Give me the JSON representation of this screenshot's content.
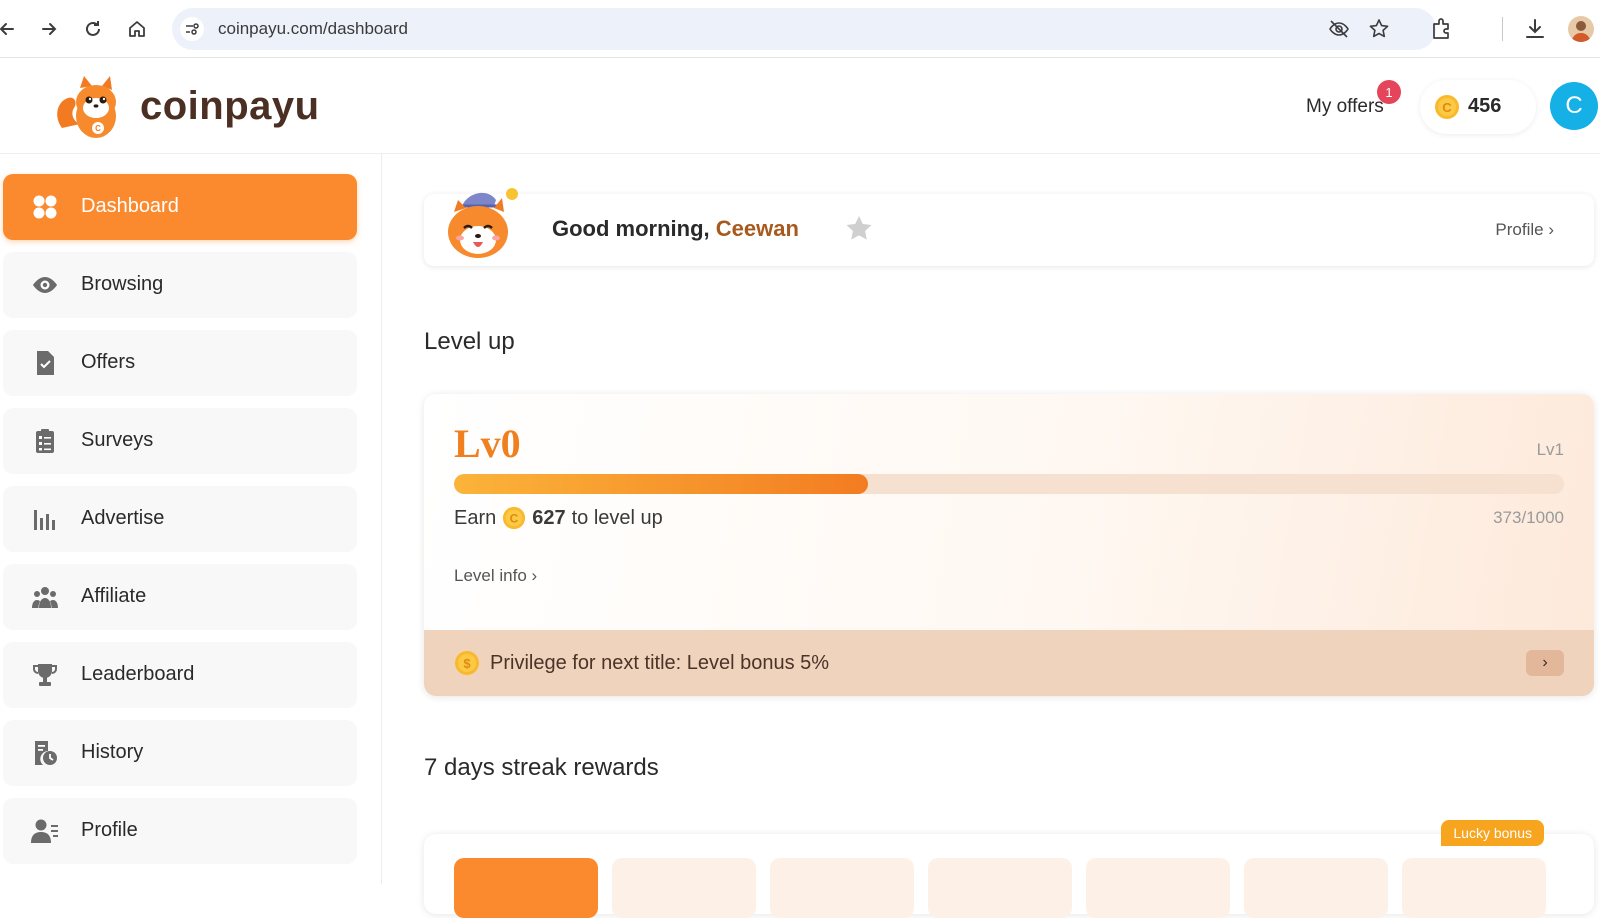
{
  "browser": {
    "url": "coinpayu.com/dashboard"
  },
  "header": {
    "brand": "coinpayu",
    "my_offers_label": "My offers",
    "my_offers_badge": "1",
    "coin_balance": "456",
    "user_initial": "C"
  },
  "sidebar": {
    "items": [
      {
        "label": "Dashboard",
        "icon": "dashboard-icon",
        "active": true
      },
      {
        "label": "Browsing",
        "icon": "eye-icon"
      },
      {
        "label": "Offers",
        "icon": "document-check-icon"
      },
      {
        "label": "Surveys",
        "icon": "clipboard-list-icon"
      },
      {
        "label": "Advertise",
        "icon": "bar-chart-icon"
      },
      {
        "label": "Affiliate",
        "icon": "users-icon"
      },
      {
        "label": "Leaderboard",
        "icon": "trophy-icon"
      },
      {
        "label": "History",
        "icon": "history-icon"
      },
      {
        "label": "Profile",
        "icon": "user-profile-icon"
      }
    ]
  },
  "greeting": {
    "prefix": "Good morning, ",
    "name": "Ceewan",
    "profile_link": "Profile ›"
  },
  "level": {
    "section_title": "Level up",
    "current": "Lv0",
    "next": "Lv1",
    "earn_prefix": "Earn",
    "earn_amount": "627",
    "earn_suffix": "to level up",
    "progress_text": "373/1000",
    "progress_fraction": 0.373,
    "info_link": "Level info ›",
    "privilege_text": "Privilege for next title: Level bonus 5%"
  },
  "streak": {
    "section_title": "7 days streak rewards",
    "lucky_label": "Lucky bonus"
  },
  "colors": {
    "accent": "#fb8a2e",
    "brand_text": "#4a2f22",
    "avatar": "#14b0e6"
  }
}
